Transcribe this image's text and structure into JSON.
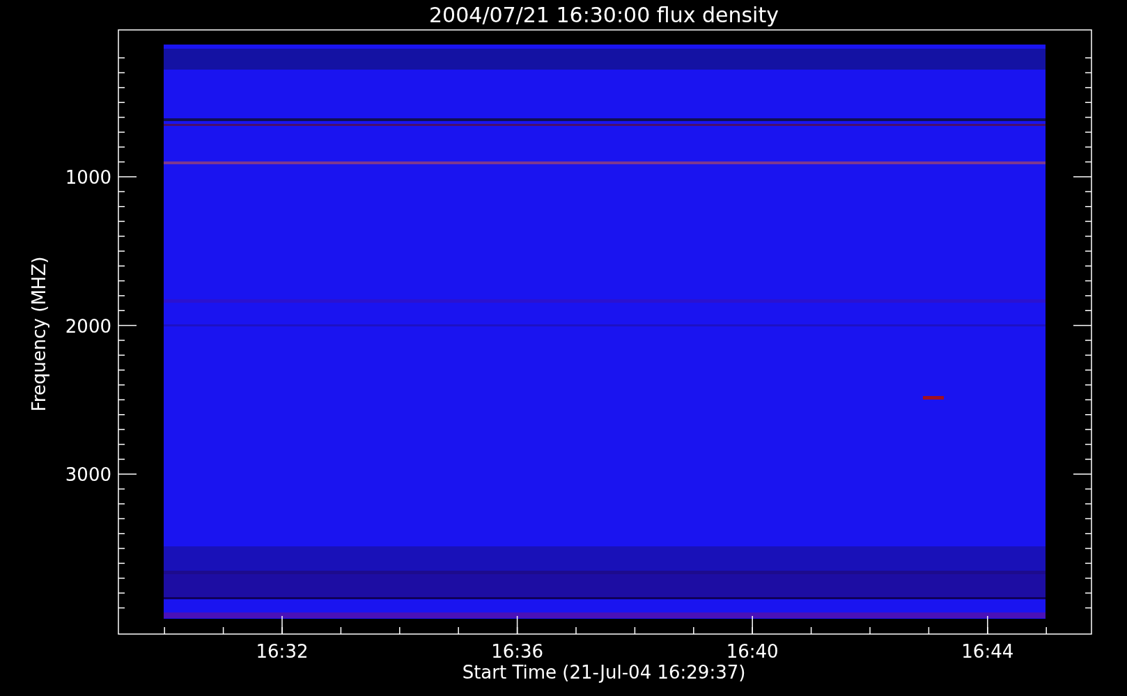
{
  "plot": {
    "title": "2004/07/21 16:30:00 flux density",
    "ylabel": "Frequency (MHZ)",
    "xlabel": "Start Time (21-Jul-04 16:29:37)",
    "yticks": [
      "1000",
      "2000",
      "3000"
    ],
    "xticks": [
      "16:32",
      "16:36",
      "16:40",
      "16:44"
    ]
  }
}
